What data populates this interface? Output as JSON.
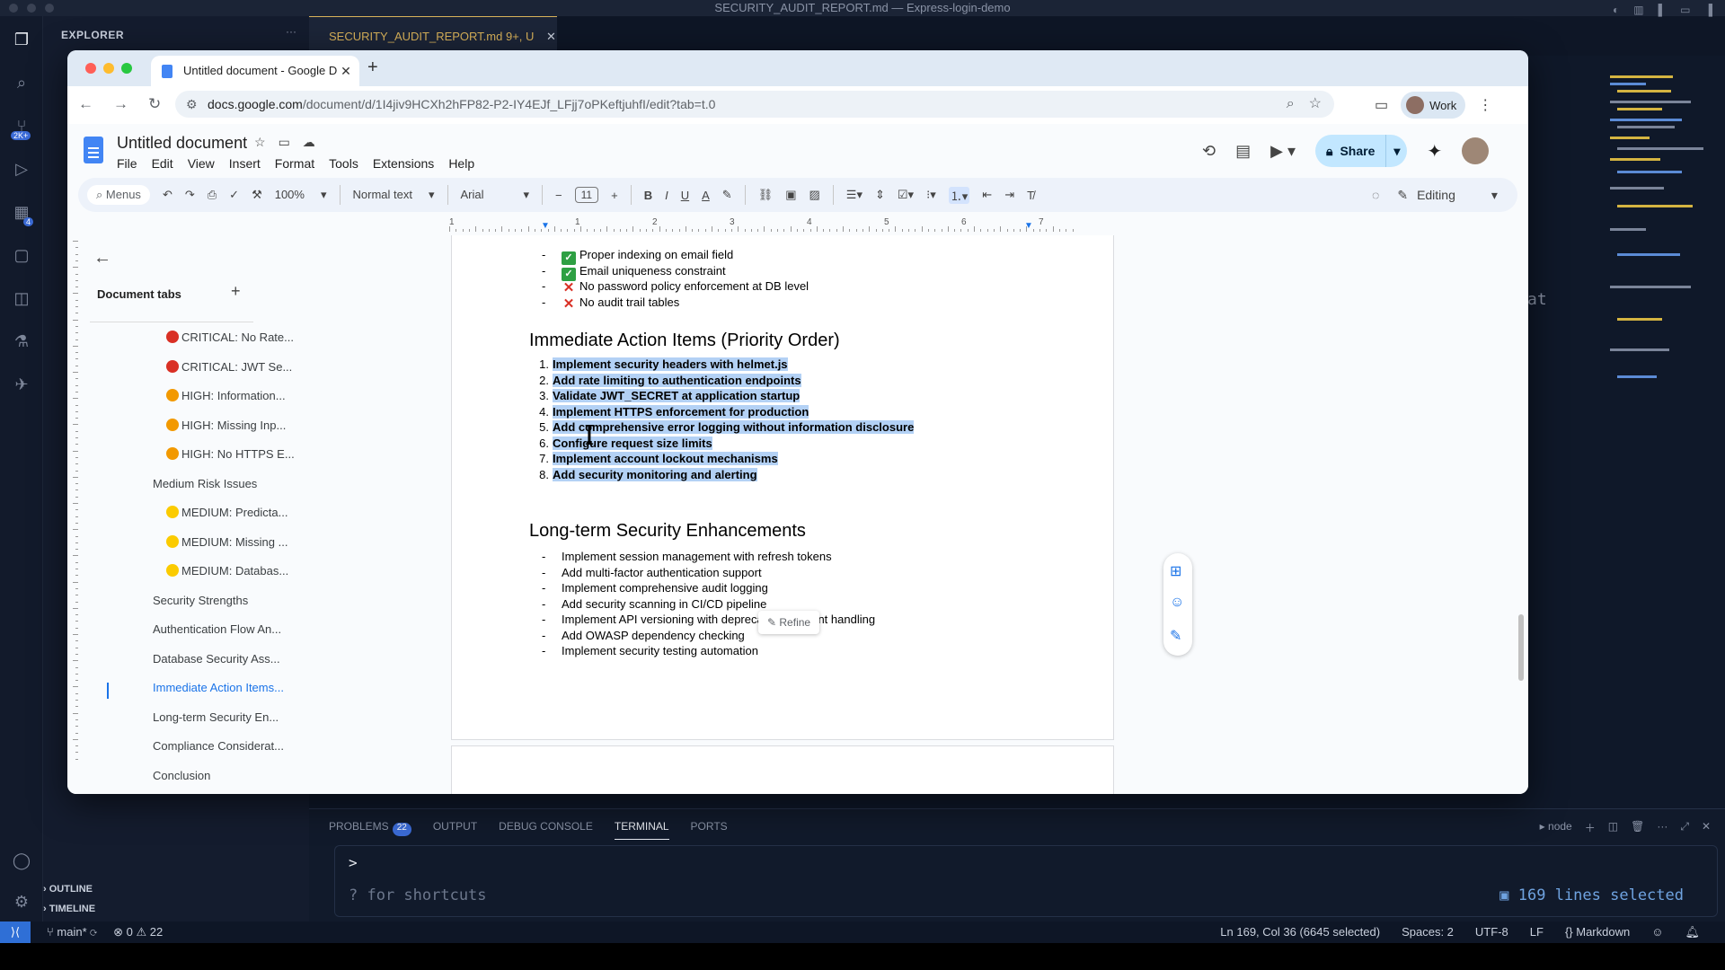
{
  "vscode": {
    "window_title": "SECURITY_AUDIT_REPORT.md — Express-login-demo",
    "explorer_header": "EXPLORER",
    "editor_tab": "SECURITY_AUDIT_REPORT.md 9+, U",
    "editor_fragment": "at",
    "activity_badge": "2K+",
    "activity_badge2": "4",
    "panel_tabs": {
      "problems": "PROBLEMS",
      "problems_count": "22",
      "output": "OUTPUT",
      "debug": "DEBUG CONSOLE",
      "terminal": "TERMINAL",
      "ports": "PORTS"
    },
    "panel_node": "node",
    "terminal_prompt": ">",
    "terminal_hint": "? for shortcuts",
    "terminal_selection": "169 lines selected",
    "outline": "OUTLINE",
    "timeline": "TIMELINE",
    "status": {
      "branch": "main*",
      "errors": "0",
      "warnings": "22",
      "position": "Ln 169, Col 36 (6645 selected)",
      "spaces": "Spaces: 2",
      "encoding": "UTF-8",
      "eol": "LF",
      "language": "Markdown"
    }
  },
  "chrome": {
    "tab_title": "Untitled document - Google D",
    "url_host": "docs.google.com",
    "url_path": "/document/d/1I4jiv9HCXh2hFP82-P2-IY4EJf_LFjj7oPKeftjuhfI/edit?tab=t.0",
    "profile": "Work"
  },
  "docs": {
    "title": "Untitled document",
    "menu": [
      "File",
      "Edit",
      "View",
      "Insert",
      "Format",
      "Tools",
      "Extensions",
      "Help"
    ],
    "share_label": "Share",
    "toolbar": {
      "menus": "Menus",
      "zoom": "100%",
      "style": "Normal text",
      "font": "Arial",
      "font_size": "11",
      "mode": "Editing"
    },
    "ruler_numbers": [
      "1",
      "1",
      "2",
      "3",
      "4",
      "5",
      "6",
      "7"
    ],
    "sidebar": {
      "heading": "Document tabs",
      "items": [
        {
          "label": "CRITICAL: No Rate...",
          "dot": "#d93025"
        },
        {
          "label": "CRITICAL: JWT Se...",
          "dot": "#d93025"
        },
        {
          "label": "HIGH: Information...",
          "dot": "#f29900"
        },
        {
          "label": "HIGH: Missing Inp...",
          "dot": "#f29900"
        },
        {
          "label": "HIGH: No HTTPS E...",
          "dot": "#f29900"
        },
        {
          "label": "Medium Risk Issues"
        },
        {
          "label": "MEDIUM: Predicta...",
          "dot": "#fbcb00"
        },
        {
          "label": "MEDIUM: Missing ...",
          "dot": "#fbcb00"
        },
        {
          "label": "MEDIUM: Databas...",
          "dot": "#fbcb00"
        },
        {
          "label": "Security Strengths"
        },
        {
          "label": "Authentication Flow An..."
        },
        {
          "label": "Database Security Ass..."
        },
        {
          "label": "Immediate Action Items..."
        },
        {
          "label": "Long-term Security En..."
        },
        {
          "label": "Compliance Considerat..."
        },
        {
          "label": "Conclusion"
        }
      ]
    },
    "body": {
      "top_bullets": [
        {
          "icon": "check",
          "text": "Proper indexing on email field"
        },
        {
          "icon": "check",
          "text": "Email uniqueness constraint"
        },
        {
          "icon": "cross",
          "text": "No password policy enforcement at DB level"
        },
        {
          "icon": "cross",
          "text": "No audit trail tables"
        }
      ],
      "heading1": "Immediate Action Items (Priority Order)",
      "numbered": [
        "Implement security headers with helmet.js",
        "Add rate limiting to authentication endpoints",
        "Validate JWT_SECRET at application startup",
        "Implement HTTPS enforcement for production",
        "Add comprehensive error logging without information disclosure",
        "Configure request size limits",
        "Implement account lockout mechanisms",
        "Add security monitoring and alerting"
      ],
      "refine": "Refine",
      "heading2": "Long-term Security Enhancements",
      "bullets2": [
        "Implement session management with refresh tokens",
        "Add multi-factor authentication support",
        "Implement comprehensive audit logging",
        "Add security scanning in CI/CD pipeline",
        "Implement API versioning with deprecated endpoint handling",
        "Add OWASP dependency checking",
        "Implement security testing automation"
      ]
    }
  }
}
